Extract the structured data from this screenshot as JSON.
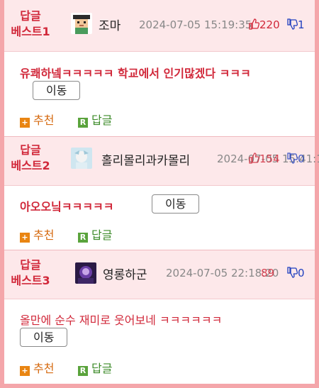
{
  "comments": [
    {
      "rank_line1": "답글",
      "rank_line2": "베스트1",
      "nickname": "조마",
      "datetime": "2024-07-05 15:19:35",
      "upvotes": "220",
      "downvotes": "1",
      "text": "유쾌하넼ㅋㅋㅋㅋㅋ 학교에서 인기많겠다 ㅋㅋㅋ",
      "move_label": "이동",
      "recommend_label": "추천",
      "reply_label": "답글",
      "avatar_icon": "pixel-character-avatar"
    },
    {
      "rank_line1": "답글",
      "rank_line2": "베스트2",
      "nickname": "홀리몰리과카몰리",
      "datetime": "2024-07-05 15:41:19:0",
      "upvotes": "154",
      "downvotes": "0",
      "text": "아오오닠ㅋㅋㅋㅋㅋ",
      "move_label": "이동",
      "recommend_label": "추천",
      "reply_label": "답글",
      "avatar_icon": "character-avatar"
    },
    {
      "rank_line1": "답글",
      "rank_line2": "베스트3",
      "nickname": "영롱하군",
      "datetime": "2024-07-05 22:18:20",
      "upvotes": "89",
      "downvotes": "0",
      "text": "올만에 순수 재미로 웃어보네 ㅋㅋㅋㅋㅋㅋ",
      "move_label": "이동",
      "recommend_label": "추천",
      "reply_label": "답글",
      "avatar_icon": "dark-character-avatar"
    }
  ],
  "colors": {
    "accent": "#d1283a",
    "header_bg": "#fde8ea",
    "frame": "#f4a6aa",
    "recommend": "#d66a10",
    "reply": "#3d8b2a",
    "downvote": "#1f3fbf"
  }
}
